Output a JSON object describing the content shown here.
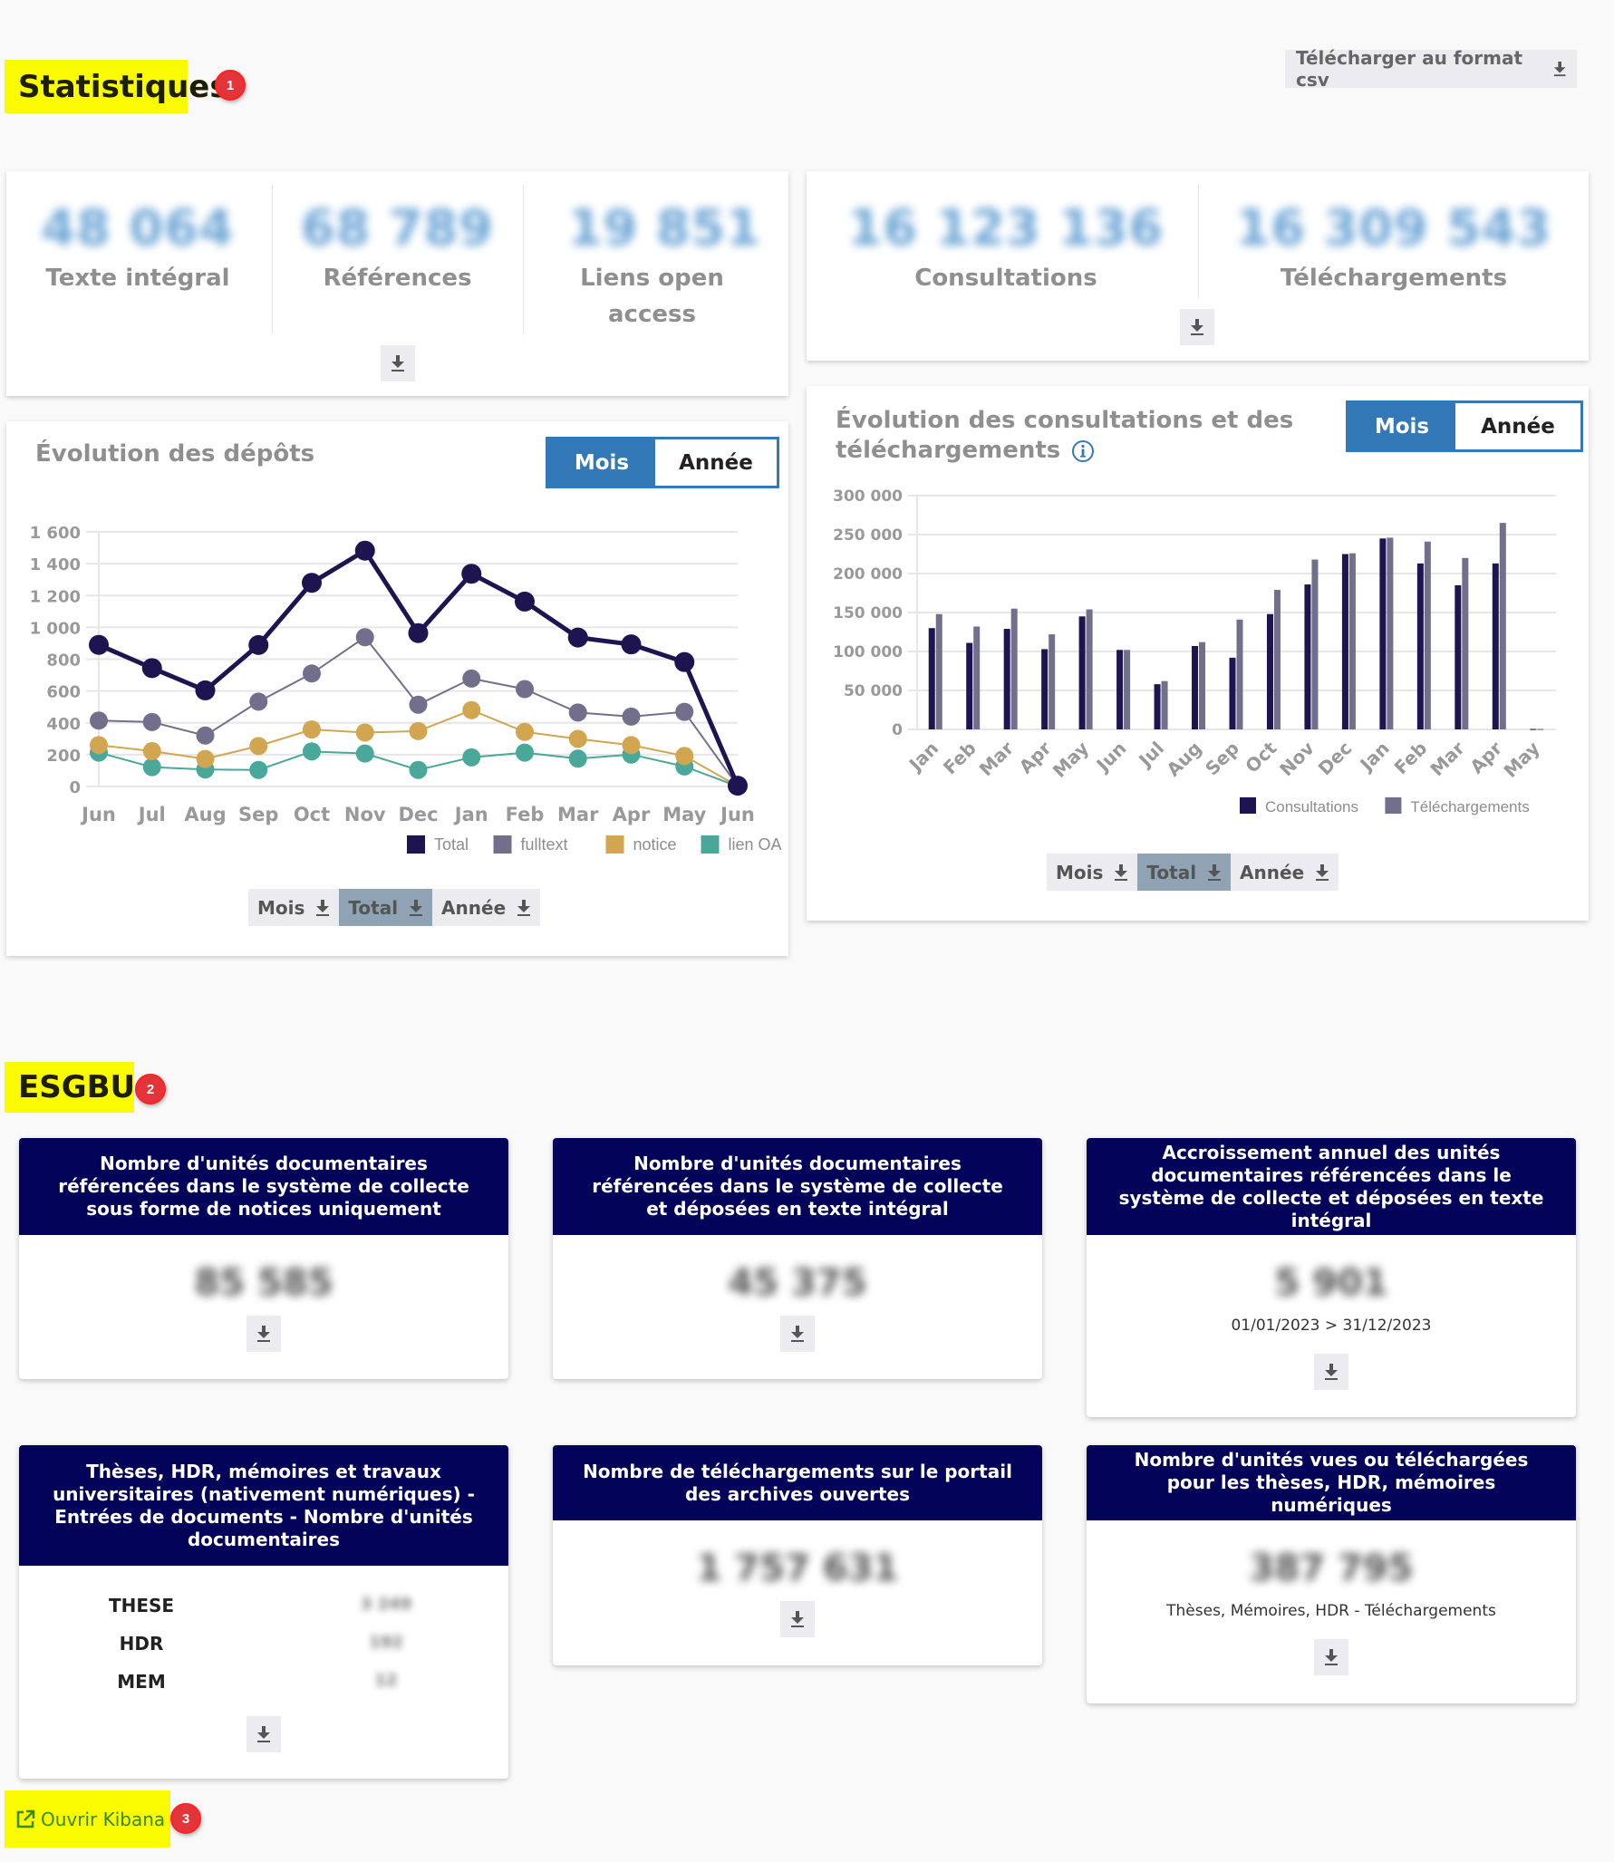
{
  "statistics": {
    "title": "Statistiques",
    "badge": "1",
    "csv_button": "Télécharger au format csv",
    "deposits_kpis": [
      {
        "value": "48 064",
        "label": "Texte intégral"
      },
      {
        "value": "68 789",
        "label": "Références"
      },
      {
        "value": "19 851",
        "label": "Liens open access"
      }
    ],
    "usage_kpis": [
      {
        "value": "16 123 136",
        "label": "Consultations"
      },
      {
        "value": "16 309 543",
        "label": "Téléchargements"
      }
    ],
    "deposits_chart": {
      "title": "Évolution des dépôts",
      "toggle": {
        "active": "Mois",
        "inactive": "Année"
      },
      "downloads": [
        "Mois",
        "Total",
        "Année"
      ],
      "active_download": "Total"
    },
    "usage_chart": {
      "title_line1": "Évolution des consultations et des",
      "title_line2": "téléchargements",
      "info_icon": "info-icon",
      "toggle": {
        "active": "Mois",
        "inactive": "Année"
      },
      "downloads": [
        "Mois",
        "Total",
        "Année"
      ],
      "active_download": "Total"
    }
  },
  "chart_data": [
    {
      "type": "line",
      "title": "Évolution des dépôts",
      "categories": [
        "Jun",
        "Jul",
        "Aug",
        "Sep",
        "Oct",
        "Nov",
        "Dec",
        "Jan",
        "Feb",
        "Mar",
        "Apr",
        "May",
        "Jun"
      ],
      "ylim": [
        0,
        1600
      ],
      "yticks": [
        0,
        200,
        400,
        600,
        800,
        1000,
        1200,
        1400,
        1600
      ],
      "ytick_labels": [
        "0",
        "200",
        "400",
        "600",
        "800",
        "1 000",
        "1 200",
        "1 400",
        "1 600"
      ],
      "grid": true,
      "legend": "bottom-right",
      "series": [
        {
          "name": "Total",
          "color": "#1e1450",
          "values": [
            890,
            744,
            604,
            889,
            1280,
            1482,
            964,
            1337,
            1162,
            936,
            893,
            782,
            5
          ]
        },
        {
          "name": "fulltext",
          "color": "#726f8c",
          "values": [
            414,
            405,
            320,
            533,
            710,
            938,
            514,
            678,
            612,
            465,
            439,
            469,
            3
          ]
        },
        {
          "name": "notice",
          "color": "#d2a550",
          "values": [
            260,
            222,
            173,
            254,
            358,
            339,
            348,
            480,
            343,
            299,
            260,
            192,
            2
          ]
        },
        {
          "name": "lien OA",
          "color": "#4aa89b",
          "values": [
            213,
            122,
            107,
            104,
            220,
            207,
            104,
            183,
            213,
            175,
            201,
            126,
            1
          ]
        }
      ]
    },
    {
      "type": "bar",
      "title": "Évolution des consultations et des téléchargements",
      "categories": [
        "Jan",
        "Feb",
        "Mar",
        "Apr",
        "May",
        "Jun",
        "Jul",
        "Aug",
        "Sep",
        "Oct",
        "Nov",
        "Dec",
        "Jan",
        "Feb",
        "Mar",
        "Apr",
        "May"
      ],
      "ylim": [
        0,
        300000
      ],
      "yticks": [
        0,
        50000,
        100000,
        150000,
        200000,
        250000,
        300000
      ],
      "ytick_labels": [
        "0",
        "50 000",
        "100 000",
        "150 000",
        "200 000",
        "250 000",
        "300 000"
      ],
      "grid": true,
      "legend": "bottom-right",
      "series": [
        {
          "name": "Consultations",
          "color": "#1e1450",
          "values": [
            130000,
            111000,
            129000,
            103000,
            145000,
            102000,
            58000,
            107000,
            92000,
            148000,
            186000,
            225000,
            245000,
            213000,
            185000,
            213000,
            500
          ]
        },
        {
          "name": "Téléchargements",
          "color": "#726f8c",
          "values": [
            148000,
            132000,
            155000,
            122000,
            154000,
            102000,
            62000,
            112000,
            141000,
            179000,
            218000,
            226000,
            246000,
            241000,
            220000,
            265000,
            500
          ]
        }
      ]
    }
  ],
  "esgbu": {
    "title": "ESGBU",
    "badge": "2",
    "cards": [
      {
        "header": "Nombre d'unités documentaires référencées dans le système de collecte sous forme de notices uniquement",
        "value": "85 585"
      },
      {
        "header": "Nombre d'unités documentaires référencées dans le système de collecte et déposées en texte intégral",
        "value": "45 375"
      },
      {
        "header": "Accroissement annuel des unités documentaires référencées dans le système de collecte et déposées en texte intégral",
        "value": "5 901",
        "subtitle": "01/01/2023 > 31/12/2023"
      },
      {
        "header": "Thèses, HDR, mémoires et travaux universitaires (nativement numériques) - Entrées de documents - Nombre d'unités documentaires",
        "rows": [
          {
            "label": "THESE",
            "value": "3 249"
          },
          {
            "label": "HDR",
            "value": "192"
          },
          {
            "label": "MEM",
            "value": "12"
          }
        ]
      },
      {
        "header": "Nombre de téléchargements sur le portail des archives ouvertes",
        "value": "1 757 631"
      },
      {
        "header": "Nombre d'unités vues ou téléchargées pour les thèses, HDR, mémoires numériques",
        "value": "387 795",
        "subtitle": "Thèses, Mémoires, HDR - Téléchargements"
      }
    ]
  },
  "kibana": {
    "label": "Ouvrir Kibana",
    "badge": "3"
  }
}
